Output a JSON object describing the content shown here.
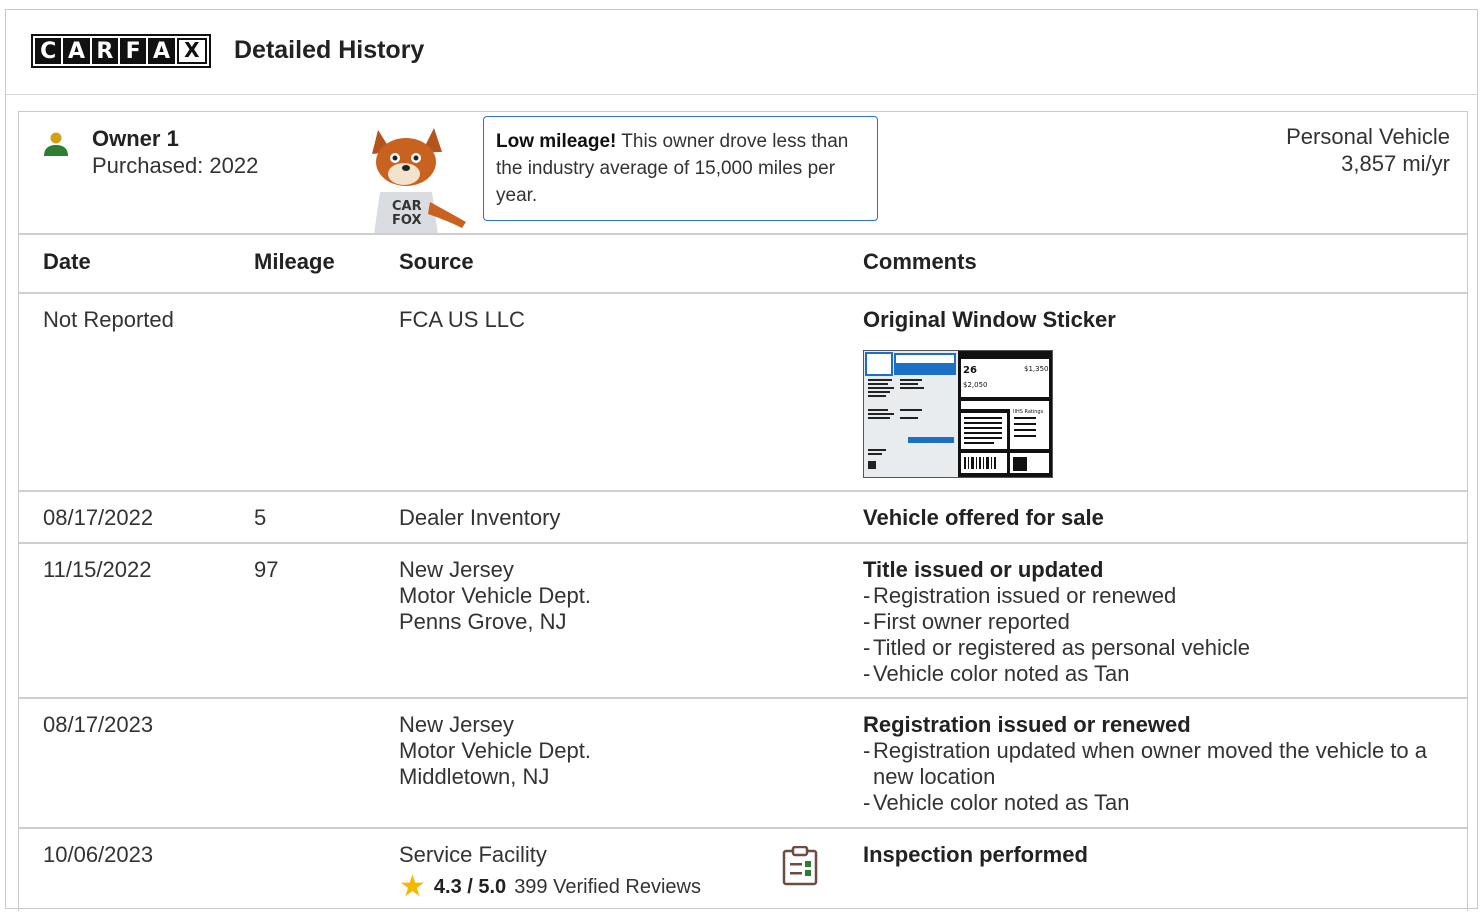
{
  "header": {
    "logo_letters": [
      "C",
      "A",
      "R",
      "F",
      "A",
      "X"
    ],
    "title": "Detailed History"
  },
  "owner": {
    "name": "Owner 1",
    "purchased": "Purchased: 2022",
    "callout_bold": "Low mileage!",
    "callout_text": " This owner drove less than the industry average of 15,000 miles per year.",
    "vehicle_type": "Personal Vehicle",
    "miles_per_year": "3,857 mi/yr"
  },
  "columns": {
    "date": "Date",
    "mileage": "Mileage",
    "source": "Source",
    "comments": "Comments"
  },
  "rows": [
    {
      "date": "Not Reported",
      "mileage": "",
      "source": [
        "FCA US LLC"
      ],
      "comment_title": "Original Window Sticker",
      "bullets": []
    },
    {
      "date": "08/17/2022",
      "mileage": "5",
      "source": [
        "Dealer Inventory"
      ],
      "comment_title": "Vehicle offered for sale",
      "bullets": []
    },
    {
      "date": "11/15/2022",
      "mileage": "97",
      "source": [
        "New Jersey",
        "Motor Vehicle Dept.",
        "Penns Grove, NJ"
      ],
      "comment_title": "Title issued or updated",
      "bullets": [
        "Registration issued or renewed",
        "First owner reported",
        "Titled or registered as personal vehicle",
        "Vehicle color noted as Tan"
      ]
    },
    {
      "date": "08/17/2023",
      "mileage": "",
      "source": [
        "New Jersey",
        "Motor Vehicle Dept.",
        "Middletown, NJ"
      ],
      "comment_title": "Registration issued or renewed",
      "bullets": [
        "Registration updated when owner moved the vehicle to a new location",
        "Vehicle color noted as Tan"
      ]
    },
    {
      "date": "10/06/2023",
      "mileage": "",
      "source": [
        "Service Facility"
      ],
      "rating": "4.3 / 5.0",
      "reviews": "399 Verified Reviews",
      "comment_title": "Inspection performed",
      "bullets": []
    }
  ],
  "sticker": {
    "mpg": "26",
    "price1": "$1,350",
    "price2": "$2,050",
    "ratings": "IIHS Ratings"
  },
  "colors": {
    "accent_blue": "#2a6fd6",
    "person_green": "#2e7d32",
    "person_head": "#d4a017",
    "star": "#f5b800",
    "clipboard": "#6d4c41"
  },
  "icons": {
    "person": "person-icon",
    "fox": "carfox-mascot",
    "star": "star-icon",
    "clipboard": "clipboard-icon"
  }
}
